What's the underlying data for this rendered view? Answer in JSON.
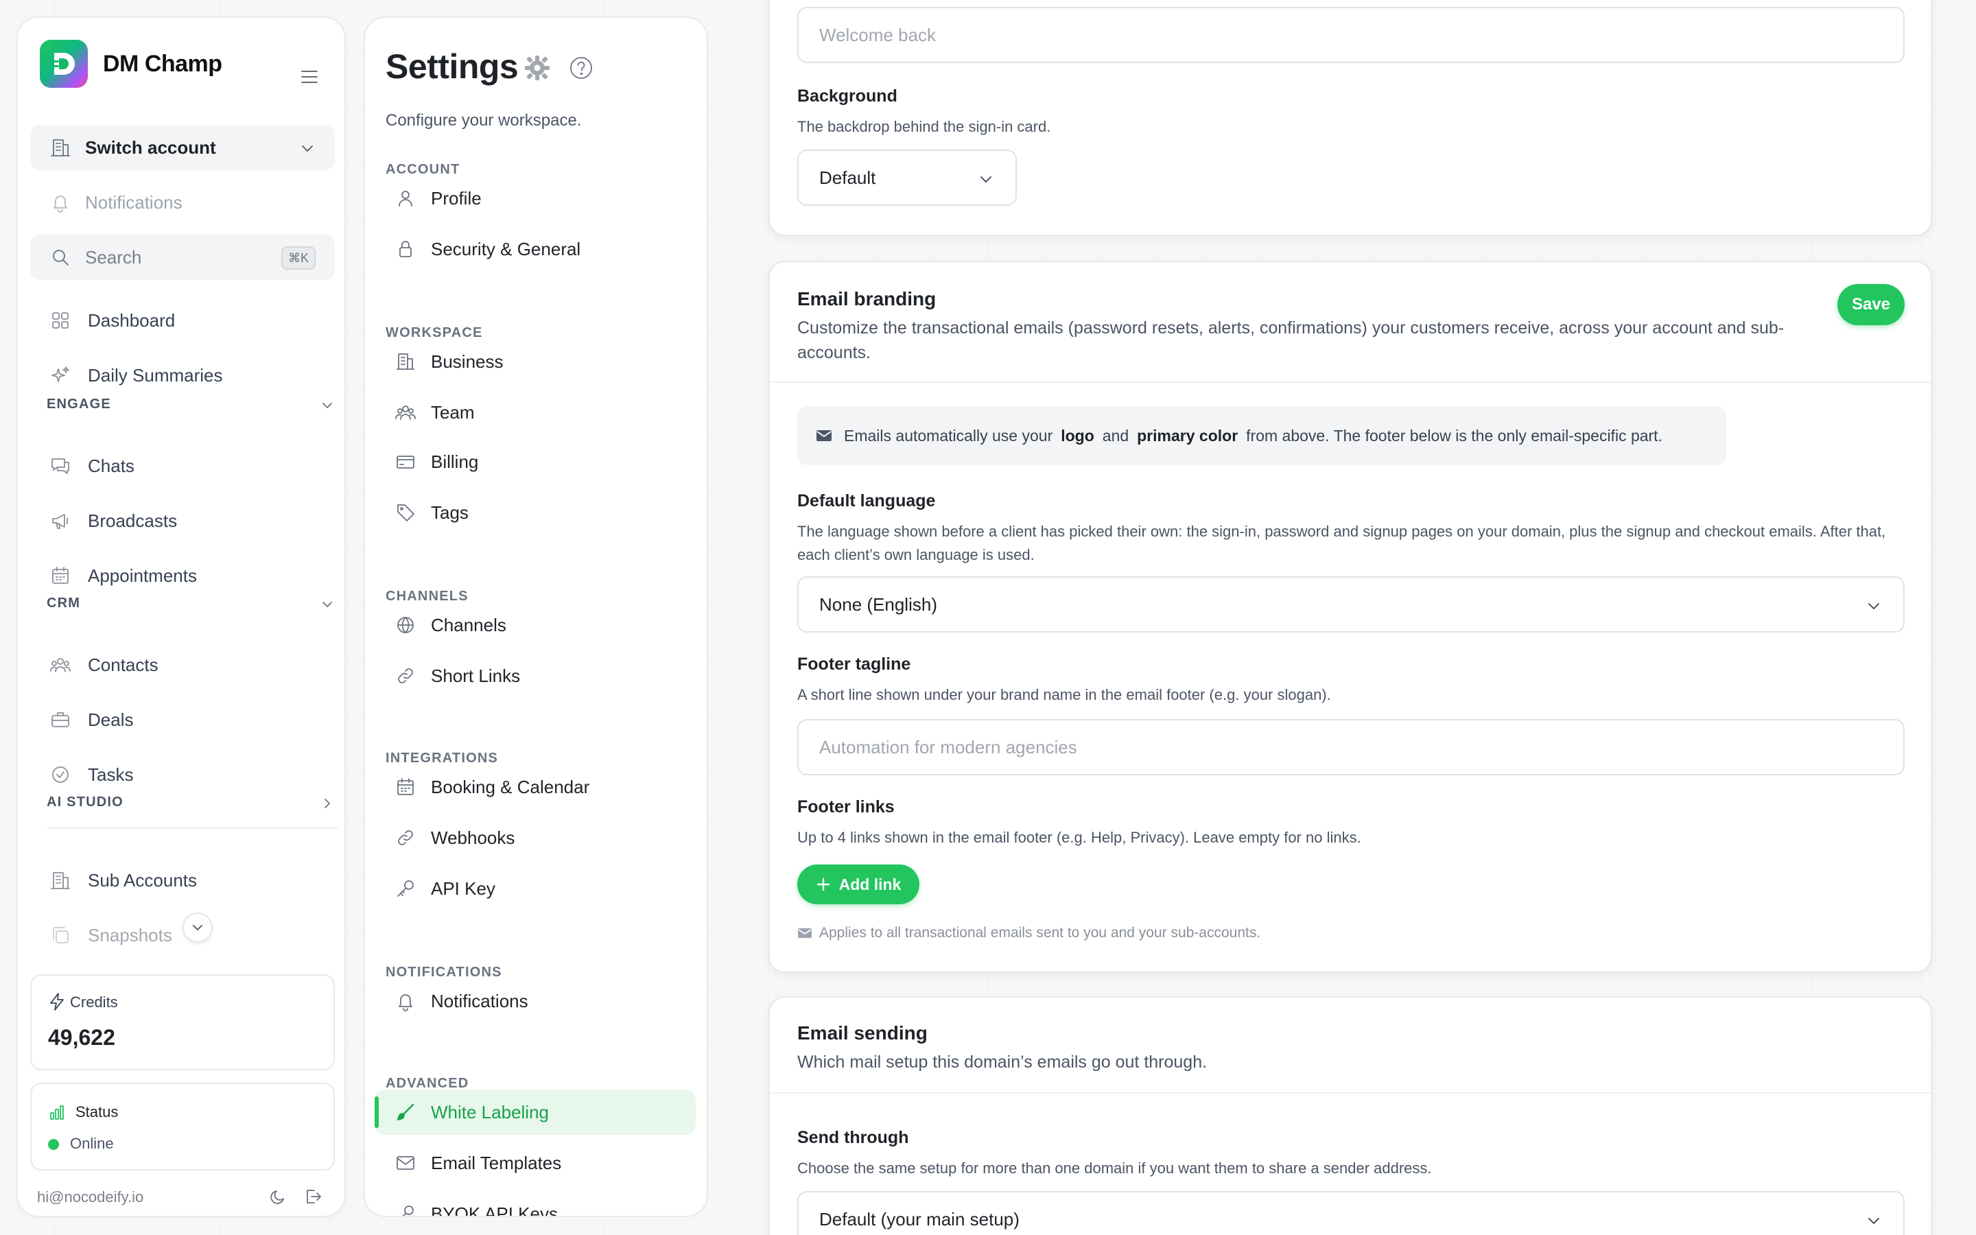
{
  "brand": {
    "name": "DM Champ"
  },
  "sidebar": {
    "switch_account": "Switch account",
    "notifications": "Notifications",
    "search_placeholder": "Search",
    "search_shortcut": "⌘K",
    "items": {
      "dashboard": "Dashboard",
      "daily_summaries": "Daily Summaries",
      "engage_section": "ENGAGE",
      "chats": "Chats",
      "broadcasts": "Broadcasts",
      "appointments": "Appointments",
      "crm_section": "CRM",
      "contacts": "Contacts",
      "deals": "Deals",
      "tasks": "Tasks",
      "ai_studio_section": "AI STUDIO",
      "sub_accounts": "Sub Accounts",
      "snapshots": "Snapshots"
    },
    "credits": {
      "label": "Credits",
      "value": "49,622"
    },
    "status": {
      "label": "Status",
      "value": "Online",
      "color": "#22c55e"
    },
    "user_email": "hi@nocodeify.io"
  },
  "settings_nav": {
    "title": "Settings",
    "subtitle": "Configure your workspace.",
    "groups": {
      "account": "ACCOUNT",
      "workspace": "WORKSPACE",
      "channels": "CHANNELS",
      "integrations": "INTEGRATIONS",
      "notifications": "NOTIFICATIONS",
      "advanced": "ADVANCED"
    },
    "items": {
      "profile": "Profile",
      "security": "Security & General",
      "business": "Business",
      "team": "Team",
      "billing": "Billing",
      "tags": "Tags",
      "channels": "Channels",
      "short_links": "Short Links",
      "booking": "Booking & Calendar",
      "webhooks": "Webhooks",
      "api_key": "API Key",
      "notifications": "Notifications",
      "white_labeling": "White Labeling",
      "email_templates": "Email Templates",
      "byok": "BYOK API Keys"
    },
    "active_item": "White Labeling",
    "accent_color": "#22c55e"
  },
  "signin_card": {
    "welcome_placeholder": "Welcome back",
    "background_label": "Background",
    "background_help": "The backdrop behind the sign-in card.",
    "background_value": "Default"
  },
  "email_branding": {
    "title": "Email branding",
    "description": "Customize the transactional emails (password resets, alerts, confirmations) your customers receive, across your account and sub-accounts.",
    "save_label": "Save",
    "info_prefix": "Emails automatically use your",
    "info_logo": "logo",
    "info_and": "and",
    "info_color": "primary color",
    "info_suffix": "from above. The footer below is the only email-specific part.",
    "default_language_label": "Default language",
    "default_language_help": "The language shown before a client has picked their own: the sign-in, password and signup pages on your domain, plus the signup and checkout emails. After that, each client’s own language is used.",
    "default_language_value": "None (English)",
    "footer_tagline_label": "Footer tagline",
    "footer_tagline_help": "A short line shown under your brand name in the email footer (e.g. your slogan).",
    "footer_tagline_placeholder": "Automation for modern agencies",
    "footer_links_label": "Footer links",
    "footer_links_help": "Up to 4 links shown in the email footer (e.g. Help, Privacy). Leave empty for no links.",
    "add_link_label": "Add link",
    "applies_note": "Applies to all transactional emails sent to you and your sub-accounts."
  },
  "email_sending": {
    "title": "Email sending",
    "description": "Which mail setup this domain’s emails go out through.",
    "send_through_label": "Send through",
    "send_through_help": "Choose the same setup for more than one domain if you want them to share a sender address.",
    "send_through_value": "Default (your main setup)"
  }
}
